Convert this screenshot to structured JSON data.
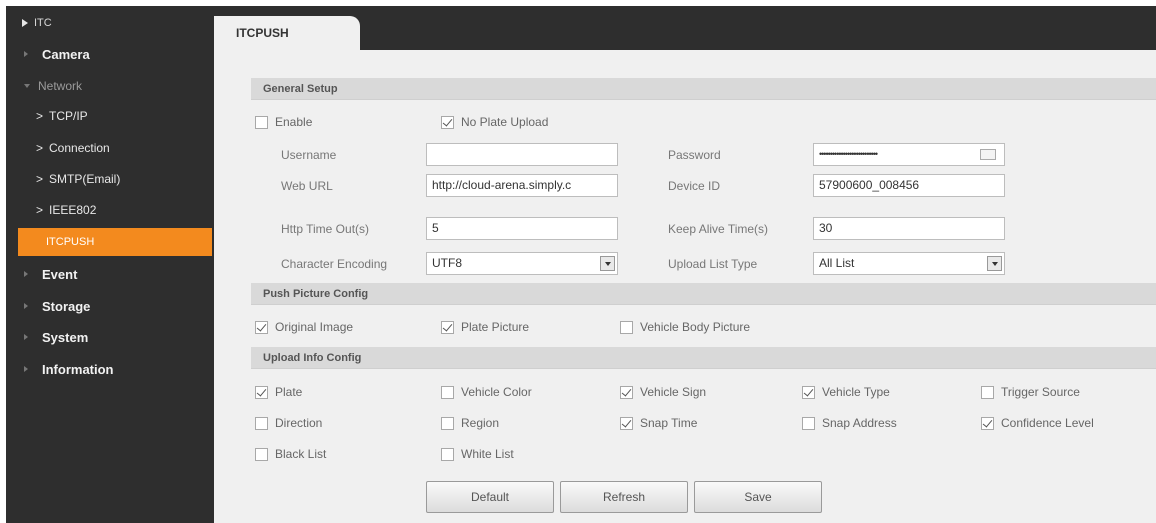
{
  "sidebar": {
    "root": "ITC",
    "camera": "Camera",
    "network": "Network",
    "subs": [
      ">",
      "TCP/IP",
      "Connection",
      "SMTP(Email)",
      "IEEE802"
    ],
    "active": "ITCPUSH",
    "event": "Event",
    "storage": "Storage",
    "system": "System",
    "information": "Information"
  },
  "tab": "ITCPUSH",
  "general": {
    "title": "General Setup",
    "enable": "Enable",
    "no_plate": "No Plate Upload",
    "username_label": "Username",
    "username_value": "",
    "password_label": "Password",
    "password_value": "•••••••••••••••••••••••••••",
    "weburl_label": "Web URL",
    "weburl_value": "http://cloud-arena.simply.c",
    "deviceid_label": "Device ID",
    "deviceid_value": "57900600_008456",
    "http_label": "Http Time Out(s)",
    "http_value": "5",
    "keepalive_label": "Keep Alive Time(s)",
    "keepalive_value": "30",
    "charenc_label": "Character Encoding",
    "charenc_value": "UTF8",
    "uploadlist_label": "Upload List Type",
    "uploadlist_value": "All List"
  },
  "push": {
    "title": "Push Picture Config",
    "original": "Original Image",
    "plate": "Plate Picture",
    "vehicle_body": "Vehicle Body Picture"
  },
  "upload": {
    "title": "Upload Info Config",
    "plate": "Plate",
    "vehicle_color": "Vehicle Color",
    "vehicle_sign": "Vehicle Sign",
    "vehicle_type": "Vehicle Type",
    "trigger_source": "Trigger Source",
    "direction": "Direction",
    "region": "Region",
    "snap_time": "Snap Time",
    "snap_address": "Snap Address",
    "confidence": "Confidence Level",
    "black_list": "Black List",
    "white_list": "White List"
  },
  "buttons": {
    "default": "Default",
    "refresh": "Refresh",
    "save": "Save"
  },
  "colors": {
    "sidebar_bg": "#2e2e2e",
    "active_item": "#f38a1e",
    "content_bg": "#f0f0f0",
    "section_bg": "#d9d9d9"
  }
}
